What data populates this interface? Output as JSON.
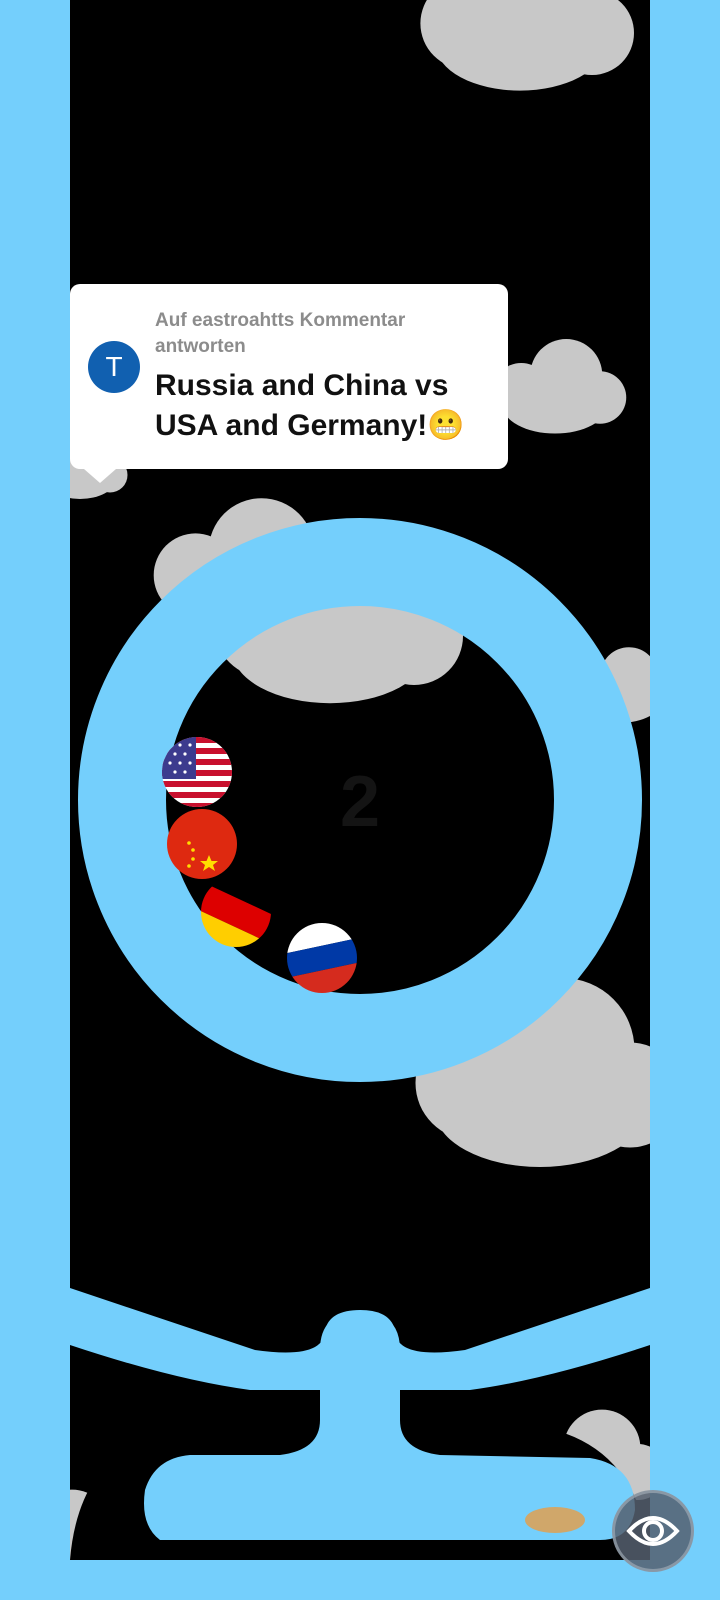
{
  "reply": {
    "avatar_letter": "T",
    "label": "Auf eastroahtts Kommentar antworten",
    "text": "Russia and China vs USA and Germany!😬"
  },
  "game": {
    "counter": "2",
    "balls": [
      "usa-flag",
      "china-flag",
      "germany-flag",
      "russia-flag"
    ]
  },
  "controls": {
    "eye_icon": "eye-icon"
  },
  "colors": {
    "track": "#74cffc",
    "background": "#000000",
    "cloud": "#c8c8c8"
  }
}
